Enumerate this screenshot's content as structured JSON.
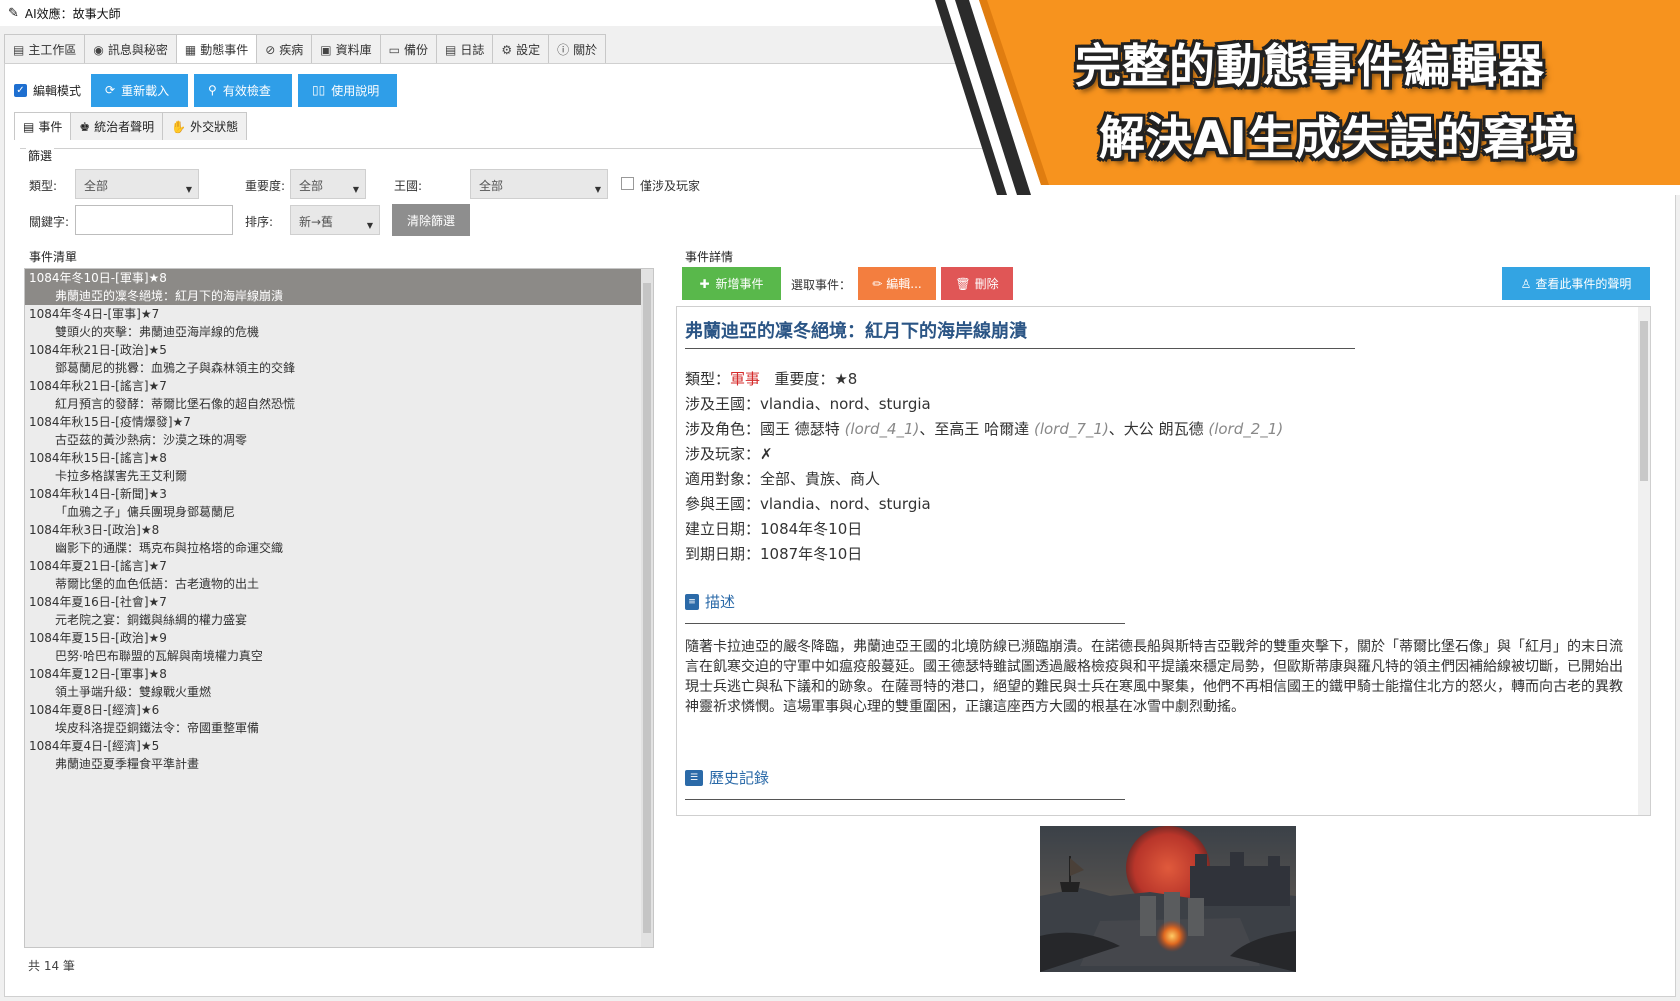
{
  "window": {
    "title": "AI效應：故事大師",
    "icon": "feather-icon"
  },
  "main_tabs": [
    {
      "label": "主工作區",
      "icon": "document-icon",
      "active": false
    },
    {
      "label": "訊息與秘密",
      "icon": "eye-icon",
      "active": false
    },
    {
      "label": "動態事件",
      "icon": "news-icon",
      "active": true
    },
    {
      "label": "疾病",
      "icon": "bandage-icon",
      "active": false
    },
    {
      "label": "資料庫",
      "icon": "database-icon",
      "active": false
    },
    {
      "label": "備份",
      "icon": "folder-icon",
      "active": false
    },
    {
      "label": "日誌",
      "icon": "log-icon",
      "active": false
    },
    {
      "label": "設定",
      "icon": "gear-icon",
      "active": false
    },
    {
      "label": "關於",
      "icon": "info-icon",
      "active": false
    }
  ],
  "toolbar": {
    "edit_mode_label": "編輯模式",
    "edit_mode_checked": true,
    "reload_label": "重新載入",
    "validate_label": "有效檢查",
    "help_label": "使用說明"
  },
  "sub_tabs": [
    {
      "label": "事件",
      "icon": "document-icon",
      "active": true
    },
    {
      "label": "統治者聲明",
      "icon": "ruler-icon",
      "active": false
    },
    {
      "label": "外交狀態",
      "icon": "handshake-icon",
      "active": false
    }
  ],
  "filter": {
    "group_title": "篩選",
    "type_label": "類型:",
    "type_value": "全部",
    "importance_label": "重要度:",
    "importance_value": "全部",
    "kingdom_label": "王國:",
    "kingdom_value": "全部",
    "player_only_label": "僅涉及玩家",
    "player_only_checked": false,
    "keyword_label": "關鍵字:",
    "keyword_value": "",
    "sort_label": "排序:",
    "sort_value": "新→舊",
    "clear_label": "清除篩選"
  },
  "event_list": {
    "title": "事件清單",
    "count_text": "共 14 筆",
    "items": [
      {
        "date": "1084年冬10日-[軍事]★8",
        "title": "弗蘭迪亞的凜冬絕境：紅月下的海岸線崩潰",
        "selected": true
      },
      {
        "date": "1084年冬4日-[軍事]★7",
        "title": "雙頭火的夾擊：弗蘭迪亞海岸線的危機",
        "selected": false
      },
      {
        "date": "1084年秋21日-[政治]★5",
        "title": "鄧葛蘭尼的挑釁：血鴉之子與森林領主的交鋒",
        "selected": false
      },
      {
        "date": "1084年秋21日-[謠言]★7",
        "title": "紅月預言的發酵：蒂爾比堡石像的超自然恐慌",
        "selected": false
      },
      {
        "date": "1084年秋15日-[疫情爆發]★7",
        "title": "古亞茲的黃沙熱病：沙漠之珠的凋零",
        "selected": false
      },
      {
        "date": "1084年秋15日-[謠言]★8",
        "title": "卡拉多格謀害先王艾利爾",
        "selected": false
      },
      {
        "date": "1084年秋14日-[新聞]★3",
        "title": "「血鴉之子」傭兵團現身鄧葛蘭尼",
        "selected": false
      },
      {
        "date": "1084年秋3日-[政治]★8",
        "title": "幽影下的通牒：瑪克布與拉格塔的命運交織",
        "selected": false
      },
      {
        "date": "1084年夏21日-[謠言]★7",
        "title": "蒂爾比堡的血色低語：古老遺物的出土",
        "selected": false
      },
      {
        "date": "1084年夏16日-[社會]★7",
        "title": "元老院之宴：銅鐵與絲綢的權力盛宴",
        "selected": false
      },
      {
        "date": "1084年夏15日-[政治]★9",
        "title": "巴努·哈巴布聯盟的瓦解與南境權力真空",
        "selected": false
      },
      {
        "date": "1084年夏12日-[軍事]★8",
        "title": "領土爭端升級：雙線戰火重燃",
        "selected": false
      },
      {
        "date": "1084年夏8日-[經濟]★6",
        "title": "埃皮科洛提亞銅鐵法令：帝國重整軍備",
        "selected": false
      },
      {
        "date": "1084年夏4日-[經濟]★5",
        "title": "弗蘭迪亞夏季糧食平準計畫",
        "selected": false
      }
    ]
  },
  "detail": {
    "group_title": "事件詳情",
    "add_label": "新增事件",
    "selected_label": "選取事件：",
    "edit_label": "編輯...",
    "delete_label": "刪除",
    "view_decl_label": "查看此事件的聲明",
    "title": "弗蘭迪亞的凜冬絕境：紅月下的海岸線崩潰",
    "type_label": "類型：",
    "type_value": "軍事",
    "importance_text": "重要度：★8",
    "kingdoms_text": "涉及王國：vlandia、nord、sturgia",
    "chars_label": "涉及角色：",
    "char1_name": "國王 德瑟特",
    "char1_id": "(lord_4_1)",
    "char2_name": "、至高王 哈爾達",
    "char2_id": "(lord_7_1)",
    "char3_name": "、大公 朗瓦德",
    "char3_id": "(lord_2_1)",
    "player_text": "涉及玩家：✗",
    "target_text": "適用對象：全部、貴族、商人",
    "participants_text": "參與王國：vlandia、nord、sturgia",
    "created_text": "建立日期：1084年冬10日",
    "expire_text": "到期日期：1087年冬10日",
    "desc_heading": "描述",
    "description": "隨著卡拉迪亞的嚴冬降臨，弗蘭迪亞王國的北境防線已瀕臨崩潰。在諾德長船與斯特吉亞戰斧的雙重夾擊下，關於「蒂爾比堡石像」與「紅月」的末日流言在飢寒交迫的守軍中如瘟疫般蔓延。國王德瑟特雖試圖透過嚴格檢疫與和平提議來穩定局勢，但歐斯蒂康與羅凡特的領主們因補給線被切斷，已開始出現士兵逃亡與私下議和的跡象。在薩哥特的港口，絕望的難民與士兵在寒風中聚集，他們不再相信國王的鐵甲騎士能擋住北方的怒火，轉而向古老的異教神靈祈求憐憫。這場軍事與心理的雙重圍困，正讓這座西方大國的根基在冰雪中劇烈動搖。",
    "history_heading": "歷史記錄"
  },
  "banner": {
    "line1": "完整的動態事件編輯器",
    "line2": "解決AI生成失誤的窘境",
    "color": "#f7931e"
  },
  "colors": {
    "accent_blue": "#2f9ee8",
    "green": "#59b84b",
    "orange": "#f37e3f",
    "red": "#e05656",
    "title_blue": "#2b5585",
    "type_red": "#d42a2a"
  }
}
